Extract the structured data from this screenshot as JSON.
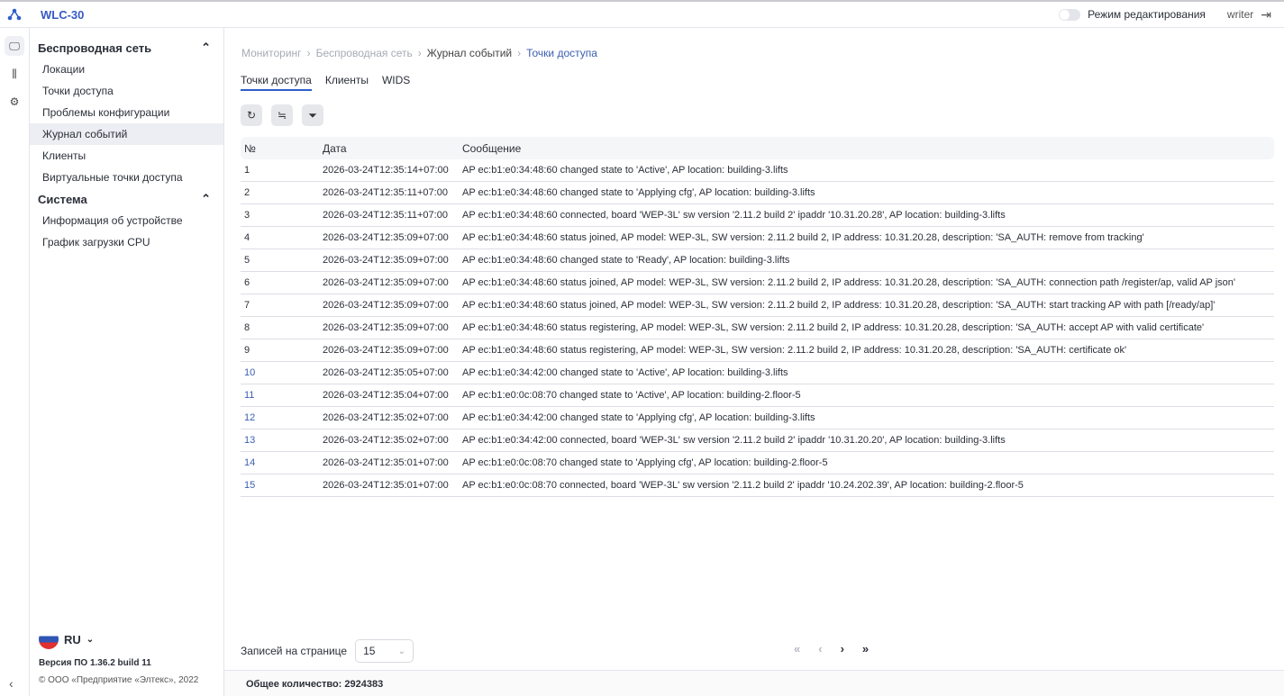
{
  "app": {
    "title": "WLC-30",
    "edit_mode_label": "Режим редактирования",
    "user": "writer"
  },
  "nav": {
    "groups": [
      {
        "label": "Беспроводная сеть",
        "items": [
          "Локации",
          "Точки доступа",
          "Проблемы конфигурации",
          "Журнал событий",
          "Клиенты",
          "Виртуальные точки доступа"
        ]
      },
      {
        "label": "Система",
        "items": [
          "Информация об устройстве",
          "График загрузки CPU"
        ]
      }
    ],
    "language": "RU",
    "version": "Версия ПО 1.36.2 build 11",
    "copyright": "© ООО «Предприятие «Элтекс», 2022"
  },
  "breadcrumb": [
    "Мониторинг",
    "Беспроводная сеть",
    "Журнал событий",
    "Точки доступа"
  ],
  "tabs": [
    "Точки доступа",
    "Клиенты",
    "WIDS"
  ],
  "table": {
    "headers": [
      "№",
      "Дата",
      "Сообщение"
    ],
    "rows": [
      [
        "1",
        "2026-03-24T12:35:14+07:00",
        "AP ec:b1:e0:34:48:60 changed state to 'Active', AP location: building-3.lifts"
      ],
      [
        "2",
        "2026-03-24T12:35:11+07:00",
        "AP ec:b1:e0:34:48:60 changed state to 'Applying cfg', AP location: building-3.lifts"
      ],
      [
        "3",
        "2026-03-24T12:35:11+07:00",
        "AP ec:b1:e0:34:48:60 connected, board 'WEP-3L' sw version '2.11.2 build 2' ipaddr '10.31.20.28', AP location: building-3.lifts"
      ],
      [
        "4",
        "2026-03-24T12:35:09+07:00",
        "AP ec:b1:e0:34:48:60 status joined, AP model: WEP-3L, SW version: 2.11.2 build 2, IP address: 10.31.20.28, description: 'SA_AUTH: remove from tracking'"
      ],
      [
        "5",
        "2026-03-24T12:35:09+07:00",
        "AP ec:b1:e0:34:48:60 changed state to 'Ready', AP location: building-3.lifts"
      ],
      [
        "6",
        "2026-03-24T12:35:09+07:00",
        "AP ec:b1:e0:34:48:60 status joined, AP model: WEP-3L, SW version: 2.11.2 build 2, IP address: 10.31.20.28, description: 'SA_AUTH: connection path /register/ap, valid AP json'"
      ],
      [
        "7",
        "2026-03-24T12:35:09+07:00",
        "AP ec:b1:e0:34:48:60 status joined, AP model: WEP-3L, SW version: 2.11.2 build 2, IP address: 10.31.20.28, description: 'SA_AUTH: start tracking AP with path [/ready/ap]'"
      ],
      [
        "8",
        "2026-03-24T12:35:09+07:00",
        "AP ec:b1:e0:34:48:60 status registering, AP model: WEP-3L, SW version: 2.11.2 build 2, IP address: 10.31.20.28, description: 'SA_AUTH: accept AP with valid certificate'"
      ],
      [
        "9",
        "2026-03-24T12:35:09+07:00",
        "AP ec:b1:e0:34:48:60 status registering, AP model: WEP-3L, SW version: 2.11.2 build 2, IP address: 10.31.20.28, description: 'SA_AUTH: certificate ok'"
      ],
      [
        "10",
        "2026-03-24T12:35:05+07:00",
        "AP ec:b1:e0:34:42:00 changed state to 'Active', AP location: building-3.lifts"
      ],
      [
        "11",
        "2026-03-24T12:35:04+07:00",
        "AP ec:b1:e0:0c:08:70 changed state to 'Active', AP location: building-2.floor-5"
      ],
      [
        "12",
        "2026-03-24T12:35:02+07:00",
        "AP ec:b1:e0:34:42:00 changed state to 'Applying cfg', AP location: building-3.lifts"
      ],
      [
        "13",
        "2026-03-24T12:35:02+07:00",
        "AP ec:b1:e0:34:42:00 connected, board 'WEP-3L' sw version '2.11.2 build 2' ipaddr '10.31.20.20', AP location: building-3.lifts"
      ],
      [
        "14",
        "2026-03-24T12:35:01+07:00",
        "AP ec:b1:e0:0c:08:70 changed state to 'Applying cfg', AP location: building-2.floor-5"
      ],
      [
        "15",
        "2026-03-24T12:35:01+07:00",
        "AP ec:b1:e0:0c:08:70 connected, board 'WEP-3L' sw version '2.11.2 build 2' ipaddr '10.24.202.39', AP location: building-2.floor-5"
      ]
    ]
  },
  "pagination": {
    "per_page_label": "Записей на странице",
    "per_page": "15",
    "total": "Общее количество: 2924383"
  }
}
